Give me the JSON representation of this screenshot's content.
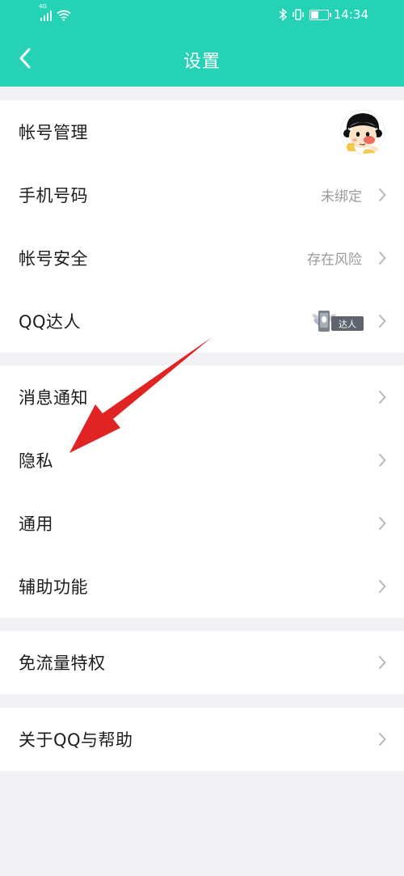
{
  "status_bar": {
    "network_hd": "4G",
    "time": "14:34"
  },
  "header": {
    "title": "设置"
  },
  "groups": [
    {
      "items": [
        {
          "label": "帐号管理",
          "value": ""
        },
        {
          "label": "手机号码",
          "value": "未绑定"
        },
        {
          "label": "帐号安全",
          "value": "存在风险"
        },
        {
          "label": "QQ达人",
          "value": "",
          "badge_text": "达人"
        }
      ]
    },
    {
      "items": [
        {
          "label": "消息通知"
        },
        {
          "label": "隐私"
        },
        {
          "label": "通用"
        },
        {
          "label": "辅助功能"
        }
      ]
    },
    {
      "items": [
        {
          "label": "免流量特权"
        }
      ]
    },
    {
      "items": [
        {
          "label": "关于QQ与帮助"
        }
      ]
    }
  ],
  "colors": {
    "header_bg": "#25d2b5",
    "page_bg": "#f2f2f6",
    "annotation_arrow": "#e02424"
  },
  "icons": [
    "back-arrow-icon",
    "chevron-right-icon",
    "avatar",
    "qq-talent-badge-icon",
    "bluetooth-icon",
    "vibrate-icon",
    "battery-icon",
    "wifi-icon",
    "signal-icon"
  ]
}
